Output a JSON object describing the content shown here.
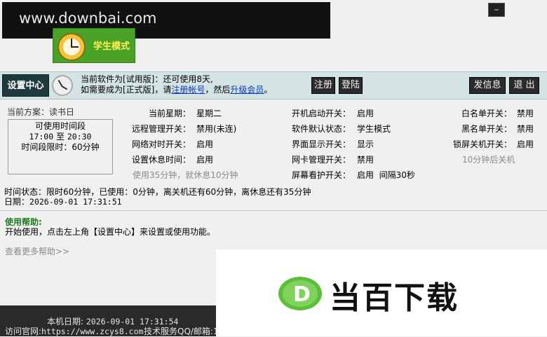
{
  "watermark_top": "www.downbai.com",
  "mode_badge": {
    "label": "学生模式"
  },
  "window": {
    "minimize_label": "–"
  },
  "toolbar": {
    "settings_center": "设置中心",
    "notice_line1": "当前软件为[试用版]：还可使用8天,",
    "notice_line2_prefix": "如需要成为[正式版]，请",
    "notice_register_link": "注册帐号",
    "notice_line2_middle": "，然后",
    "notice_upgrade_link": "升级会员",
    "notice_line2_suffix": "。",
    "register_button": "注册",
    "login_button": "登陆",
    "send_message_button": "发信息",
    "exit_button": "退 出"
  },
  "plan": {
    "label": "当前方案：读书日",
    "box_title": "可使用时间段",
    "start_time": "17:00",
    "to": "至",
    "end_time": "20:30",
    "limit": "时间段限时：60分钟"
  },
  "settings": {
    "col1": [
      {
        "label": "当前星期：",
        "value": "星期二"
      },
      {
        "label": "远程管理开关：",
        "value": "禁用(未连)"
      },
      {
        "label": "网络对时开关：",
        "value": "启用"
      },
      {
        "label": "设置休息时间：",
        "value": "启用"
      }
    ],
    "col1_note": "使用35分钟，就休息10分钟",
    "col2": [
      {
        "label": "开机启动开关：",
        "value": "启用"
      },
      {
        "label": "软件默认状态：",
        "value": "学生模式"
      },
      {
        "label": "界面显示开关：",
        "value": "显示"
      },
      {
        "label": "网卡管理开关：",
        "value": "禁用"
      },
      {
        "label": "屏幕看护开关：",
        "value": "启用  间隔30秒"
      }
    ],
    "col3": [
      {
        "label": "白名单开关：",
        "value": "禁用"
      },
      {
        "label": "黑名单开关：",
        "value": "禁用"
      },
      {
        "label": "锁屏关机开关：",
        "value": "启用"
      }
    ],
    "col3_note": "10分钟后关机"
  },
  "status": {
    "time_status": "时间状态：限时60分钟，已使用：0分钟，离关机还有60分钟，离休息还有35分钟",
    "date_label": "日期：",
    "date_value": "2026-09-01 17:31:51"
  },
  "help": {
    "title": "使用帮助:",
    "text": "开始使用，点击左上角【设置中心】来设置或使用功能。",
    "more": "查看更多帮助>>"
  },
  "footer": {
    "machine_date_label": "本机日期:",
    "machine_date_value": "2026-09-01 17:31:54",
    "site_label": "访问官网:",
    "site_value": "https://www.zcys8.com",
    "support_label": "技术服务QQ/邮箱:1"
  },
  "watermark_bottom": {
    "text": "当百下载",
    "logo_letter": "D"
  },
  "colors": {
    "accent_green": "#4aa326",
    "top_bar": "#d4e3e3",
    "dark_button": "#2b2b2b",
    "link_blue": "#0a38b5",
    "help_green": "#1e7a1e"
  }
}
